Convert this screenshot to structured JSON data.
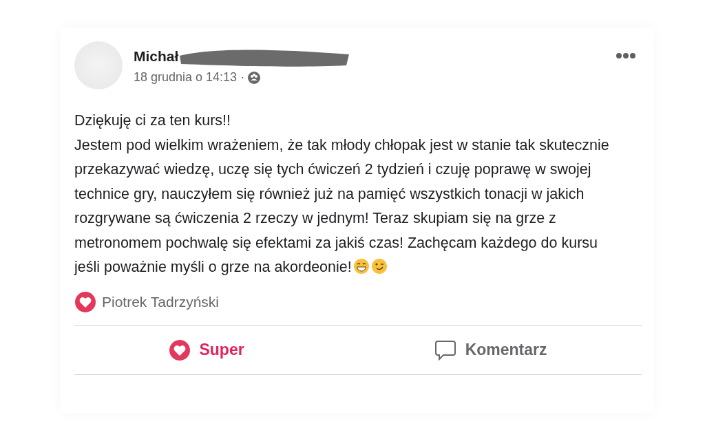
{
  "post": {
    "author": "Michał",
    "author_redacted": true,
    "time": "18 grudnia o 14:13 ·",
    "paragraphs": [
      "Dziękuję ci za ten kurs!!",
      "Jestem pod wielkim wrażeniem, że tak młody chłopak jest w stanie tak skutecznie przekazywać wiedzę, uczę się tych ćwiczeń 2 tydzień i czuję poprawę w swojej technice gry, nauczyłem się również już na pamięć wszystkich tonacji w jakich rozgrywane są ćwiczenia 2 rzeczy w jednym! Teraz skupiam się na grze z metronomem pochwalę się efektami za jakiś czas! Zachęcam każdego do kursu jeśli poważnie myśli o grze na akordeonie!"
    ],
    "emojis": [
      {
        "kind": "grin"
      },
      {
        "kind": "wink"
      }
    ],
    "reactions": {
      "names": "Piotrek Tadrzyński"
    },
    "actions": [
      {
        "kind": "react",
        "label": "Super",
        "reacted": true
      },
      {
        "kind": "comment",
        "label": "Komentarz"
      }
    ]
  }
}
